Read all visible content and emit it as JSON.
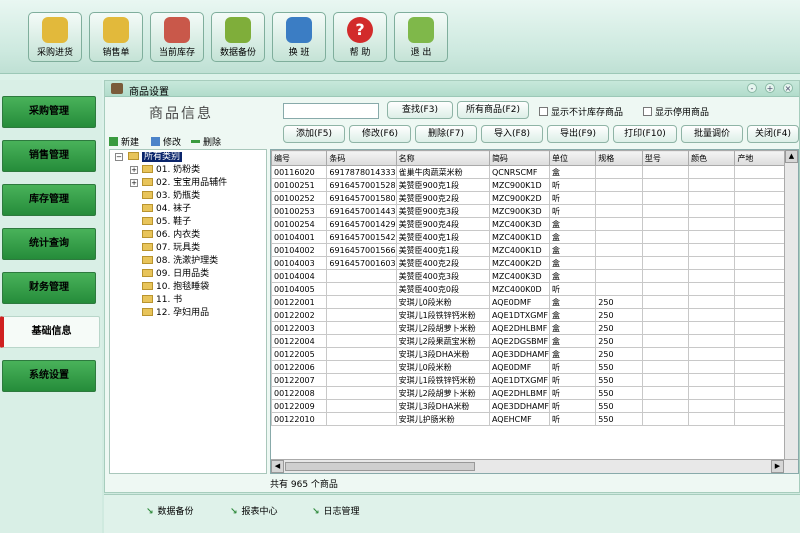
{
  "toolbar": [
    {
      "label": "采购进货",
      "icon": "purchase-icon",
      "color": "#e2b93b"
    },
    {
      "label": "销售单",
      "icon": "sales-icon",
      "color": "#e2b93b"
    },
    {
      "label": "当前库存",
      "icon": "house-icon",
      "color": "#c9584a"
    },
    {
      "label": "数据备份",
      "icon": "backup-icon",
      "color": "#7fae3a"
    },
    {
      "label": "换  班",
      "icon": "users-icon",
      "color": "#3b7dc4"
    },
    {
      "label": "帮  助",
      "icon": "help-icon",
      "color": "#d22b2b"
    },
    {
      "label": "退  出",
      "icon": "exit-icon",
      "color": "#7fb84a"
    }
  ],
  "nav": [
    "采购管理",
    "销售管理",
    "库存管理",
    "统计查询",
    "财务管理",
    "基础信息",
    "系统设置"
  ],
  "panel": {
    "title": "商品设置",
    "heading": "商品信息",
    "search_value": "",
    "find_button": "查找(F3)",
    "all_button": "所有商品(F2)",
    "check_no_stock": "显示不计库存商品",
    "check_disabled": "显示停用商品",
    "actions": [
      "添加(F5)",
      "修改(F6)",
      "删除(F7)",
      "导入(F8)",
      "导出(F9)",
      "打印(F10)",
      "批量调价",
      "关闭(F4)"
    ],
    "tree_actions": {
      "new": "新建",
      "edit": "修改",
      "delete": "删除"
    }
  },
  "tree": {
    "root": "所有类别",
    "items": [
      "01. 奶粉类",
      "02. 宝宝用品辅件",
      "03. 奶瓶类",
      "04. 袜子",
      "05. 鞋子",
      "06. 内衣类",
      "07. 玩具类",
      "08. 洗漱护理类",
      "09. 日用品类",
      "10. 抱毯睡袋",
      "11. 书",
      "12. 孕妇用品"
    ]
  },
  "grid": {
    "columns": [
      "编号",
      "条码",
      "名称",
      "简码",
      "单位",
      "规格",
      "型号",
      "颜色",
      "产地"
    ],
    "rows": [
      [
        "00116020",
        "6917878014333",
        "雀巢牛肉蔬菜米粉",
        "QCNRSCMF",
        "盒",
        "",
        "",
        "",
        ""
      ],
      [
        "00100251",
        "6916457001528",
        "美赞臣900克1段",
        "MZC900K1D",
        "听",
        "",
        "",
        "",
        ""
      ],
      [
        "00100252",
        "6916457001580",
        "美赞臣900克2段",
        "MZC900K2D",
        "听",
        "",
        "",
        "",
        ""
      ],
      [
        "00100253",
        "6916457001443",
        "美赞臣900克3段",
        "MZC900K3D",
        "听",
        "",
        "",
        "",
        ""
      ],
      [
        "00100254",
        "6916457001429",
        "美赞臣900克4段",
        "MZC400K3D",
        "盒",
        "",
        "",
        "",
        ""
      ],
      [
        "00104001",
        "6916457001542",
        "美赞臣400克1段",
        "MZC400K1D",
        "盒",
        "",
        "",
        "",
        ""
      ],
      [
        "00104002",
        "6916457001566",
        "美赞臣400克1段",
        "MZC400K1D",
        "盒",
        "",
        "",
        "",
        ""
      ],
      [
        "00104003",
        "6916457001603",
        "美赞臣400克2段",
        "MZC400K2D",
        "盒",
        "",
        "",
        "",
        ""
      ],
      [
        "00104004",
        "",
        "美赞臣400克3段",
        "MZC400K3D",
        "盒",
        "",
        "",
        "",
        ""
      ],
      [
        "00104005",
        "",
        "美赞臣400克0段",
        "MZC400K0D",
        "听",
        "",
        "",
        "",
        ""
      ],
      [
        "00122001",
        "",
        "安琪儿0段米粉",
        "AQE0DMF",
        "盒",
        "250",
        "",
        "",
        ""
      ],
      [
        "00122002",
        "",
        "安琪儿1段铁锌钙米粉",
        "AQE1DTXGMF",
        "盒",
        "250",
        "",
        "",
        ""
      ],
      [
        "00122003",
        "",
        "安琪儿2段胡萝卜米粉",
        "AQE2DHLBMF",
        "盒",
        "250",
        "",
        "",
        ""
      ],
      [
        "00122004",
        "",
        "安琪儿2段果蔬宝米粉",
        "AQE2DGSBMF",
        "盒",
        "250",
        "",
        "",
        ""
      ],
      [
        "00122005",
        "",
        "安琪儿3段DHA米粉",
        "AQE3DDHAMF",
        "盒",
        "250",
        "",
        "",
        ""
      ],
      [
        "00122006",
        "",
        "安琪儿0段米粉",
        "AQE0DMF",
        "听",
        "550",
        "",
        "",
        ""
      ],
      [
        "00122007",
        "",
        "安琪儿1段铁锌钙米粉",
        "AQE1DTXGMF",
        "听",
        "550",
        "",
        "",
        ""
      ],
      [
        "00122008",
        "",
        "安琪儿2段胡萝卜米粉",
        "AQE2DHLBMF",
        "听",
        "550",
        "",
        "",
        ""
      ],
      [
        "00122009",
        "",
        "安琪儿3段DHA米粉",
        "AQE3DDHAMF",
        "听",
        "550",
        "",
        "",
        ""
      ],
      [
        "00122010",
        "",
        "安琪儿护肠米粉",
        "AQEHCMF",
        "听",
        "550",
        "",
        "",
        ""
      ]
    ]
  },
  "status_text": "共有 965 个商品",
  "bottom_links": [
    "数据备份",
    "报表中心",
    "日志管理"
  ]
}
